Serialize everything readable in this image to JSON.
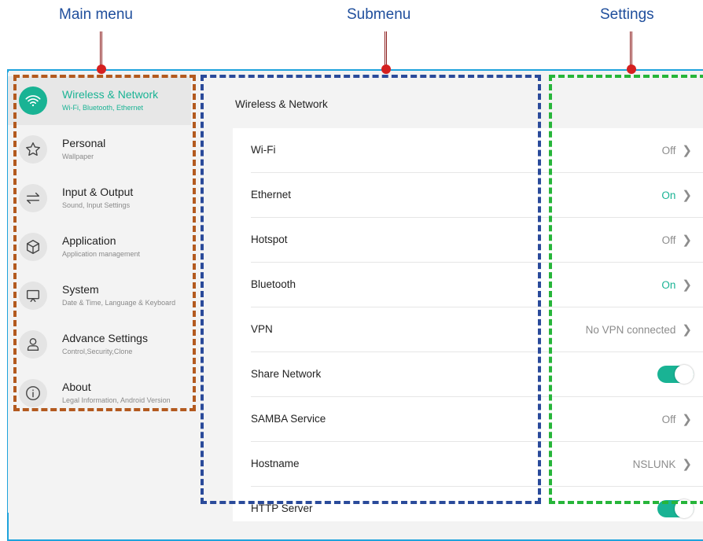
{
  "annotations": {
    "main_menu": "Main menu",
    "submenu": "Submenu",
    "settings": "Settings"
  },
  "sidebar": {
    "items": [
      {
        "title": "Wireless & Network",
        "subtitle": "Wi-Fi, Bluetooth, Ethernet",
        "icon": "wifi-icon",
        "active": true
      },
      {
        "title": "Personal",
        "subtitle": "Wallpaper",
        "icon": "star-icon",
        "active": false
      },
      {
        "title": "Input & Output",
        "subtitle": "Sound, Input Settings",
        "icon": "arrows-swap-icon",
        "active": false
      },
      {
        "title": "Application",
        "subtitle": "Application management",
        "icon": "cube-icon",
        "active": false
      },
      {
        "title": "System",
        "subtitle": "Date & Time, Language & Keyboard",
        "icon": "monitor-icon",
        "active": false
      },
      {
        "title": "Advance Settings",
        "subtitle": "Control,Security,Clone",
        "icon": "user-icon",
        "active": false
      },
      {
        "title": "About",
        "subtitle": "Legal Information, Android Version",
        "icon": "info-icon",
        "active": false
      }
    ]
  },
  "main": {
    "section_title": "Wireless & Network",
    "rows": [
      {
        "label": "Wi-Fi",
        "value": "Off",
        "type": "link"
      },
      {
        "label": "Ethernet",
        "value": "On",
        "type": "link"
      },
      {
        "label": "Hotspot",
        "value": "Off",
        "type": "link"
      },
      {
        "label": "Bluetooth",
        "value": "On",
        "type": "link"
      },
      {
        "label": "VPN",
        "value": "No VPN connected",
        "type": "link"
      },
      {
        "label": "Share Network",
        "value": true,
        "type": "toggle"
      },
      {
        "label": "SAMBA Service",
        "value": "Off",
        "type": "link"
      },
      {
        "label": "Hostname",
        "value": "NSLUNK",
        "type": "link"
      },
      {
        "label": "HTTP Server",
        "value": true,
        "type": "toggle"
      }
    ]
  },
  "colors": {
    "accent": "#19b394",
    "frame": "#1ea3dc",
    "main_menu_box": "#b35a1f",
    "submenu_box": "#2a4a9a",
    "settings_box": "#27b53a",
    "annotation_text": "#1f4e9c"
  }
}
